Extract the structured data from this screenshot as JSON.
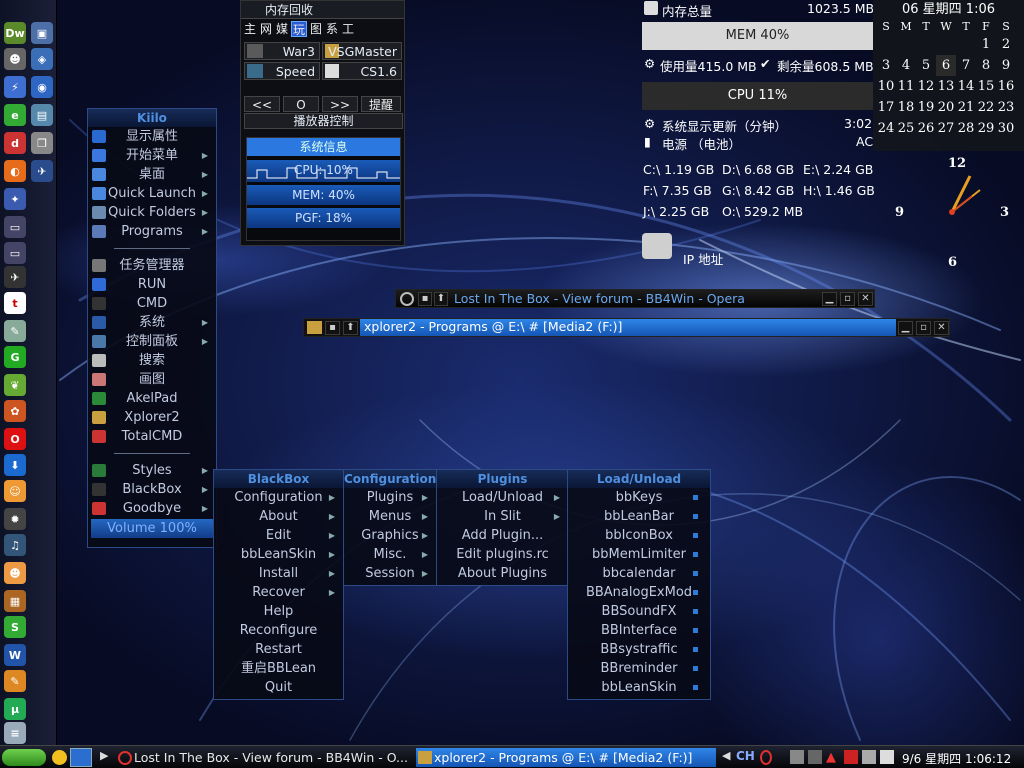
{
  "colors": {
    "accent": "#2f7bd8",
    "menu_title": "#4f8fe0",
    "bar_fill": "#d8d8d8"
  },
  "kiko_menu": {
    "title": "Kiilo",
    "items": [
      {
        "label": "显示属性",
        "arrow": false,
        "icon": "display-icon"
      },
      {
        "label": "开始菜单",
        "arrow": true,
        "icon": "folder-icon"
      },
      {
        "label": "桌面",
        "arrow": true,
        "icon": "folder-icon"
      },
      {
        "label": "Quick Launch",
        "arrow": true,
        "icon": "folder-icon"
      },
      {
        "label": "Quick Folders",
        "arrow": true,
        "icon": "folder-icon"
      },
      {
        "label": "Programs",
        "arrow": true,
        "icon": "programs-icon"
      }
    ],
    "items2": [
      {
        "label": "任务管理器",
        "arrow": false,
        "icon": "task-manager-icon"
      },
      {
        "label": "RUN",
        "arrow": false,
        "icon": "run-icon"
      },
      {
        "label": "CMD",
        "arrow": false,
        "icon": "cmd-icon"
      },
      {
        "label": "系统",
        "arrow": true,
        "icon": "system-icon"
      },
      {
        "label": "控制面板",
        "arrow": true,
        "icon": "control-panel-icon"
      },
      {
        "label": "搜索",
        "arrow": false,
        "icon": "search-icon"
      },
      {
        "label": "画图",
        "arrow": false,
        "icon": "paint-icon"
      },
      {
        "label": "AkelPad",
        "arrow": false,
        "icon": "akelpad-icon"
      },
      {
        "label": "Xplorer2",
        "arrow": false,
        "icon": "xplorer2-icon"
      },
      {
        "label": "TotalCMD",
        "arrow": false,
        "icon": "totalcmd-icon"
      }
    ],
    "items3": [
      {
        "label": "Styles",
        "arrow": true,
        "icon": "styles-icon"
      },
      {
        "label": "BlackBox",
        "arrow": true,
        "icon": "blackbox-icon"
      },
      {
        "label": "Goodbye",
        "arrow": true,
        "icon": "goodbye-icon"
      }
    ],
    "volume": "Volume 100%"
  },
  "blackbox_menu": {
    "title": "BlackBox",
    "items": [
      {
        "label": "Configuration",
        "arrow": true
      },
      {
        "label": "About",
        "arrow": true
      },
      {
        "label": "Edit",
        "arrow": true
      },
      {
        "label": "bbLeanSkin",
        "arrow": true
      },
      {
        "label": "Install",
        "arrow": true
      },
      {
        "label": "Recover",
        "arrow": true
      },
      {
        "label": "Help",
        "arrow": false
      },
      {
        "label": "Reconfigure",
        "arrow": false
      },
      {
        "label": "Restart",
        "arrow": false
      },
      {
        "label": "重启BBLean",
        "arrow": false
      },
      {
        "label": "Quit",
        "arrow": false
      }
    ]
  },
  "config_menu": {
    "title": "Configuration",
    "items": [
      {
        "label": "Plugins",
        "arrow": true
      },
      {
        "label": "Menus",
        "arrow": true
      },
      {
        "label": "Graphics",
        "arrow": true
      },
      {
        "label": "Misc.",
        "arrow": true
      },
      {
        "label": "Session",
        "arrow": true
      }
    ]
  },
  "plugins_menu": {
    "title": "Plugins",
    "items": [
      {
        "label": "Load/Unload",
        "arrow": true
      },
      {
        "label": "In Slit",
        "arrow": true
      },
      {
        "label": "Add Plugin...",
        "arrow": false
      },
      {
        "label": "Edit plugins.rc",
        "arrow": false
      },
      {
        "label": "About Plugins",
        "arrow": false
      }
    ]
  },
  "load_menu": {
    "title": "Load/Unload",
    "items": [
      "bbKeys",
      "bbLeanBar",
      "bbIconBox",
      "bbMemLimiter",
      "bbcalendar",
      "BBAnalogExMod",
      "BBSoundFX",
      "BBInterface",
      "BBsystraffic",
      "BBreminder",
      "bbLeanSkin"
    ]
  },
  "player": {
    "title": "内存回收",
    "tabs": [
      "主",
      "网",
      "媒",
      "玩",
      "图",
      "系",
      "工"
    ],
    "active_tab": 3,
    "games": [
      {
        "name": "War3",
        "icon": "war3-icon"
      },
      {
        "name": "VSGMaster",
        "icon": "vsgmaster-icon"
      },
      {
        "name": "Speed",
        "icon": "speed-icon"
      },
      {
        "name": "CS1.6",
        "icon": "cs-icon"
      }
    ],
    "controls": [
      "<<",
      "O",
      ">>",
      "提醒"
    ],
    "player_label": "播放器控制",
    "sysinfo_label": "系统信息",
    "cpu": "CPU: 10%",
    "mem": "MEM: 40%",
    "pgf": "PGF: 18%"
  },
  "sysinfo": {
    "mem_total_label": "内存总量",
    "mem_total": "1023.5 MB",
    "mem_bar": "MEM 40%",
    "mem_fraction": 0.4,
    "used_label": "使用量415.0 MB",
    "free_label": "剩余量608.5 MB",
    "cpu_bar": "CPU 11%",
    "cpu_fraction": 0.11,
    "update_label": "系统显示更新（分钟）",
    "update_time": "3:02",
    "power_label": "电源 （电池）",
    "power_value": "AC",
    "drives": [
      [
        "C:\\ 1.19 GB",
        "D:\\ 6.68 GB",
        "E:\\ 2.24 GB"
      ],
      [
        "F:\\ 7.35 GB",
        "G:\\ 8.42 GB",
        "H:\\ 1.46 GB"
      ],
      [
        "J:\\ 2.25 GB",
        "O:\\ 529.2 MB",
        ""
      ]
    ],
    "ip_label": "IP 地址"
  },
  "calendar": {
    "header": "06 星期四 1:06",
    "day_names": [
      "S",
      "M",
      "T",
      "W",
      "T",
      "F",
      "S"
    ],
    "weeks": [
      [
        "",
        "",
        "",
        "",
        "",
        "1",
        "2"
      ],
      [
        "3",
        "4",
        "5",
        "6",
        "7",
        "8",
        "9"
      ],
      [
        "10",
        "11",
        "12",
        "13",
        "14",
        "15",
        "16"
      ],
      [
        "17",
        "18",
        "19",
        "20",
        "21",
        "22",
        "23"
      ],
      [
        "24",
        "25",
        "26",
        "27",
        "28",
        "29",
        "30"
      ]
    ],
    "today": "6"
  },
  "clock": {
    "labels": [
      "12",
      "3",
      "6",
      "9"
    ]
  },
  "windows": {
    "opera_title": "Lost In The Box - View forum - BB4Win - Opera",
    "xplorer_title": "xplorer2 - Programs @ E:\\ # [Media2 (F:)]"
  },
  "taskbar": {
    "tasks": [
      "Lost In The Box - View forum - BB4Win - O...",
      "xplorer2 - Programs @ E:\\ # [Media2 (F:)]"
    ],
    "lang": "CH",
    "clock": "9/6 星期四 1:06:12"
  }
}
